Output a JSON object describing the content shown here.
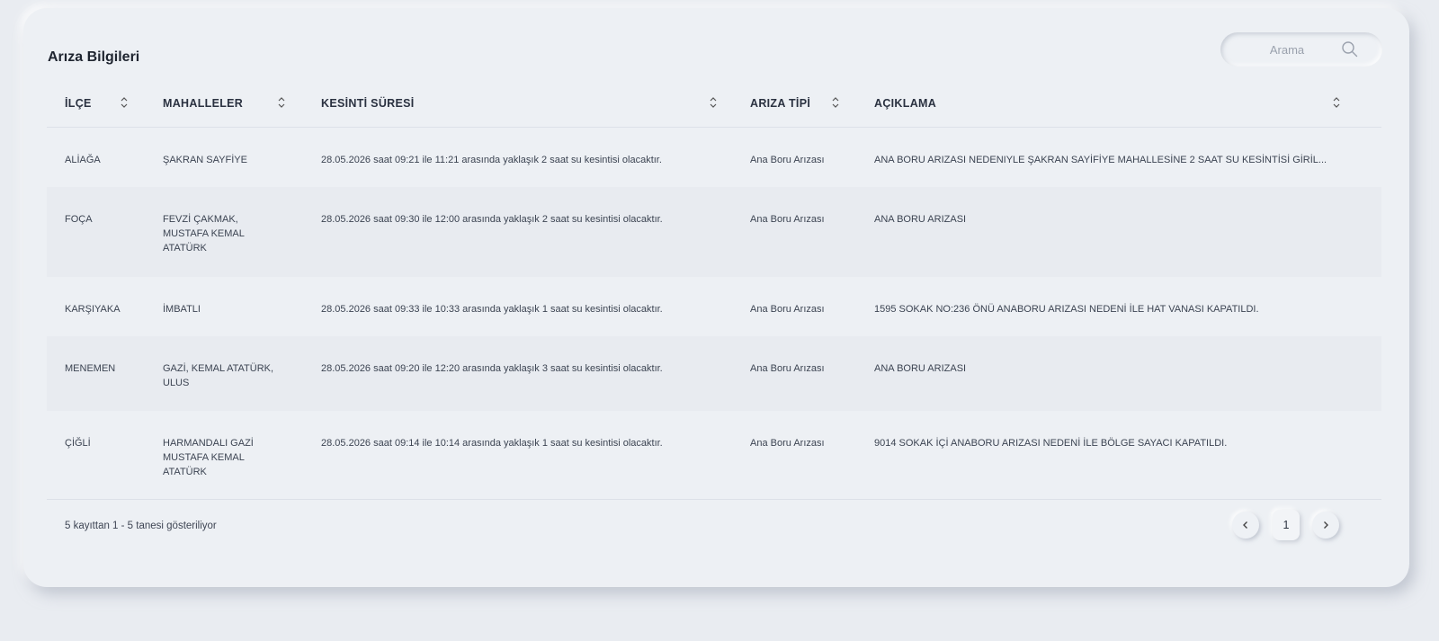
{
  "card": {
    "title": "Arıza Bilgileri"
  },
  "search": {
    "placeholder": "Arama"
  },
  "table": {
    "columns": [
      "İLÇE",
      "MAHALLELER",
      "KESİNTİ SÜRESİ",
      "ARIZA TİPİ",
      "AÇIKLAMA"
    ],
    "rows": [
      {
        "ilce": "ALİAĞA",
        "mahalleler": "ŞAKRAN SAYFİYE",
        "sure": "28.05.2026 saat 09:21 ile 11:21 arasında yaklaşık 2 saat su kesintisi olacaktır.",
        "tip": "Ana Boru Arızası",
        "aciklama": "ANA BORU ARIZASI NEDENIYLE ŞAKRAN SAYİFİYE MAHALLESİNE 2 SAAT SU KESİNTİSİ GİRİL..."
      },
      {
        "ilce": "FOÇA",
        "mahalleler": "FEVZİ ÇAKMAK, MUSTAFA KEMAL ATATÜRK",
        "sure": "28.05.2026 saat 09:30 ile 12:00 arasında yaklaşık 2 saat su kesintisi olacaktır.",
        "tip": "Ana Boru Arızası",
        "aciklama": "ANA BORU ARIZASI"
      },
      {
        "ilce": "KARŞIYAKA",
        "mahalleler": "İMBATLI",
        "sure": "28.05.2026 saat 09:33 ile 10:33 arasında yaklaşık 1 saat su kesintisi olacaktır.",
        "tip": "Ana Boru Arızası",
        "aciklama": "1595 SOKAK NO:236 ÖNÜ ANABORU ARIZASI NEDENİ İLE HAT VANASI KAPATILDI."
      },
      {
        "ilce": "MENEMEN",
        "mahalleler": "GAZİ, KEMAL ATATÜRK, ULUS",
        "sure": "28.05.2026 saat 09:20 ile 12:20 arasında yaklaşık 3 saat su kesintisi olacaktır.",
        "tip": "Ana Boru Arızası",
        "aciklama": "ANA BORU ARIZASI"
      },
      {
        "ilce": "ÇİĞLİ",
        "mahalleler": "HARMANDALI GAZİ MUSTAFA KEMAL ATATÜRK",
        "sure": "28.05.2026 saat 09:14 ile 10:14 arasında yaklaşık 1 saat su kesintisi olacaktır.",
        "tip": "Ana Boru Arızası",
        "aciklama": "9014 SOKAK İÇİ ANABORU ARIZASI NEDENİ İLE BÖLGE SAYACI KAPATILDI."
      }
    ]
  },
  "footer": {
    "info": "5 kayıttan 1 - 5 tanesi gösteriliyor",
    "page": "1",
    "prev_icon": "chevron-left-icon",
    "next_icon": "chevron-right-icon"
  }
}
